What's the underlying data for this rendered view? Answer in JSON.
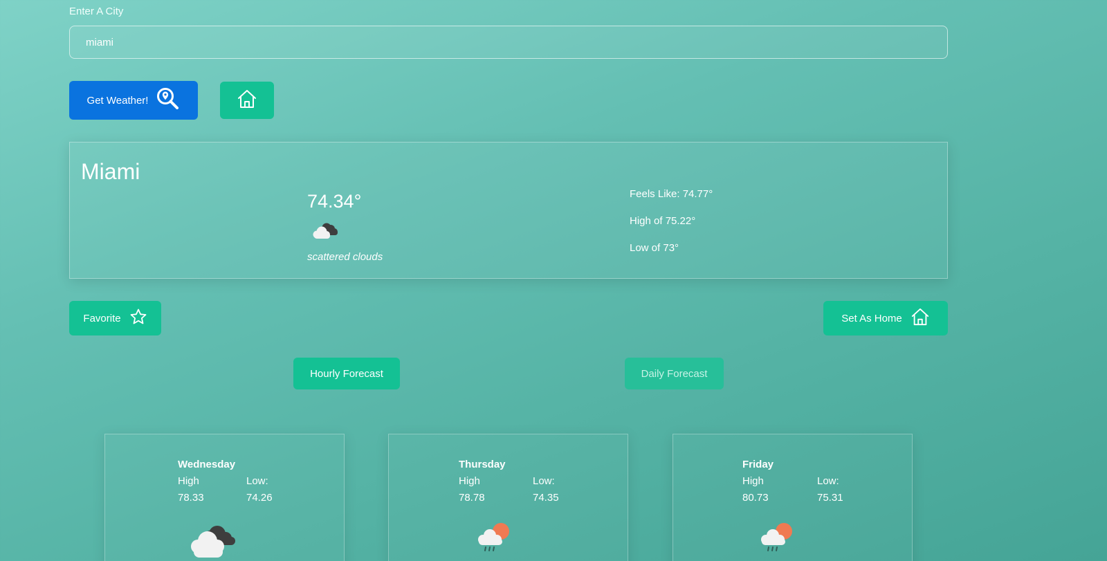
{
  "search": {
    "label": "Enter A City",
    "value": "miami",
    "get_weather_label": "Get Weather!",
    "get_weather_icon": "location-search-icon",
    "home_icon": "home-icon"
  },
  "current": {
    "city": "Miami",
    "temperature": "74.34°",
    "condition_icon": "scattered-clouds-icon",
    "condition": "scattered clouds",
    "feels_like": "Feels Like: 74.77°",
    "high": "High of 75.22°",
    "low": "Low of 73°"
  },
  "actions": {
    "favorite_label": "Favorite",
    "favorite_icon": "star-icon",
    "set_home_label": "Set As Home",
    "set_home_icon": "home-icon"
  },
  "forecast_tabs": {
    "hourly_label": "Hourly Forecast",
    "daily_label": "Daily Forecast"
  },
  "daily": [
    {
      "day": "Wednesday",
      "high_label": "High",
      "low_label": "Low:",
      "high": "78.33",
      "low": "74.26",
      "icon": "cloudy-icon"
    },
    {
      "day": "Thursday",
      "high_label": "High",
      "low_label": "Low:",
      "high": "78.78",
      "low": "74.35",
      "icon": "sun-rain-icon"
    },
    {
      "day": "Friday",
      "high_label": "High",
      "low_label": "Low:",
      "high": "80.73",
      "low": "75.31",
      "icon": "sun-rain-icon"
    }
  ],
  "colors": {
    "primary_blue": "#0a73df",
    "accent_green": "#14c194",
    "sun_orange": "#f07a52"
  }
}
